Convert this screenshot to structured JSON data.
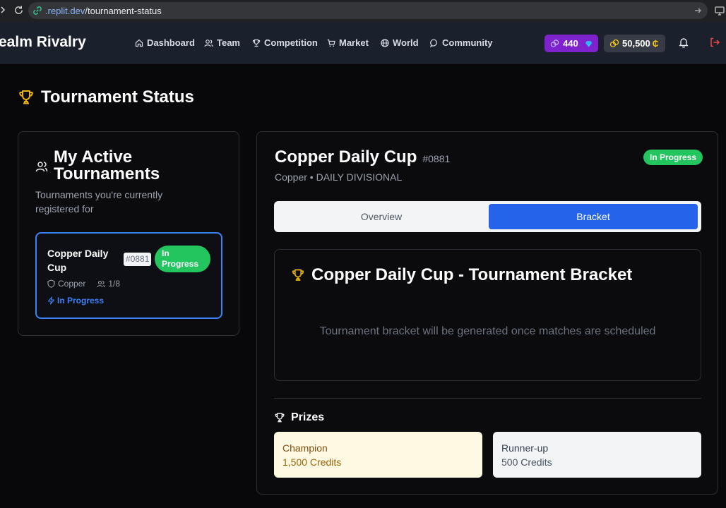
{
  "browser": {
    "url_domain": ".replit.dev",
    "url_path": "/tournament-status"
  },
  "header": {
    "brand": "ealm Rivalry",
    "nav": [
      "Dashboard",
      "Team",
      "Competition",
      "Market",
      "World",
      "Community"
    ],
    "gems": "440",
    "coins": "50,500",
    "accent_gems": "#7e22ce"
  },
  "page": {
    "title": "Tournament Status"
  },
  "active": {
    "title": "My Active Tournaments",
    "subtitle": "Tournaments you're currently registered for",
    "card": {
      "name": "Copper Daily Cup",
      "id": "#0881",
      "badge": "In Progress",
      "division": "Copper",
      "players": "1/8",
      "status": "In Progress"
    }
  },
  "detail": {
    "name": "Copper Daily Cup",
    "id": "#0881",
    "badge": "In Progress",
    "subtitle": "Copper • DAILY DIVISIONAL",
    "tabs": [
      "Overview",
      "Bracket"
    ],
    "active_tab": "Bracket",
    "bracket_title": "Copper Daily Cup - Tournament Bracket",
    "bracket_empty": "Tournament bracket will be generated once matches are scheduled",
    "prizes_title": "Prizes",
    "prizes": [
      {
        "place": "Champion",
        "amount": "1,500 Credits"
      },
      {
        "place": "Runner-up",
        "amount": "500 Credits"
      }
    ]
  }
}
